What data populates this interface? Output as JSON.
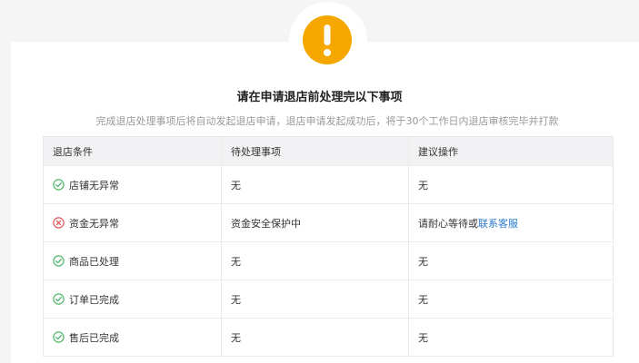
{
  "dialog": {
    "title": "请在申请退店前处理完以下事项",
    "subtitle": "完成退店处理事项后将自动发起退店申请，退店申请发起成功后，将于30个工作日内退店审核完毕并打款",
    "icon": "exclamation-warning-icon",
    "accent_color": "#f5a700"
  },
  "table": {
    "headers": [
      "退店条件",
      "待处理事项",
      "建议操作"
    ],
    "rows": [
      {
        "condition": "店铺无异常",
        "status_icon": "check-circle-icon",
        "pending": "无",
        "action_text": "无",
        "action_link": ""
      },
      {
        "condition": "资金无异常",
        "status_icon": "error-circle-icon",
        "pending": "资金安全保护中",
        "action_text": "请耐心等待或",
        "action_link": "联系客服"
      },
      {
        "condition": "商品已处理",
        "status_icon": "check-circle-icon",
        "pending": "无",
        "action_text": "无",
        "action_link": ""
      },
      {
        "condition": "订单已完成",
        "status_icon": "check-circle-icon",
        "pending": "无",
        "action_text": "无",
        "action_link": ""
      },
      {
        "condition": "售后已完成",
        "status_icon": "check-circle-icon",
        "pending": "无",
        "action_text": "无",
        "action_link": ""
      }
    ],
    "colors": {
      "ok": "#52b76a",
      "error": "#e05a5a",
      "link": "#2a7ad0"
    }
  }
}
